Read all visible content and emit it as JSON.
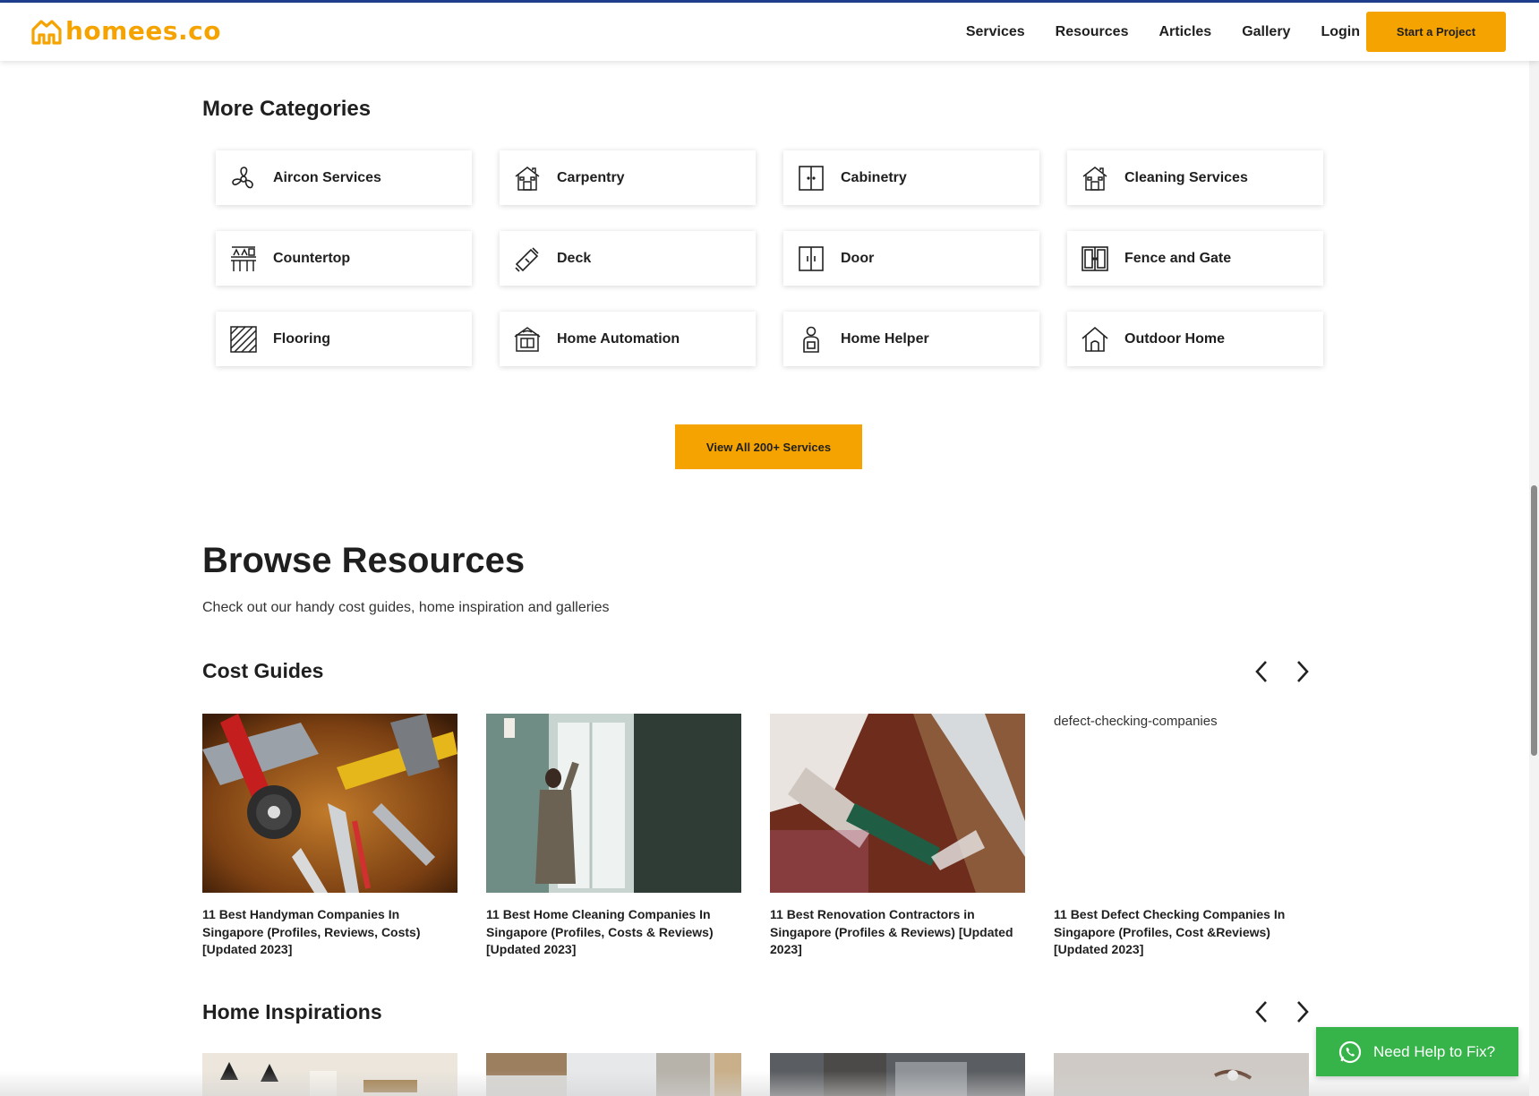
{
  "brand": {
    "name": "homees.co",
    "accent": "#f5a300",
    "top_line_color": "#1f3f8f"
  },
  "header": {
    "nav": [
      "Services",
      "Resources",
      "Articles",
      "Gallery",
      "Login"
    ],
    "cta_label": "Start a Project"
  },
  "more_categories": {
    "title": "More Categories",
    "items": [
      {
        "label": "Aircon Services",
        "icon": "fan-icon"
      },
      {
        "label": "Carpentry",
        "icon": "house-icon"
      },
      {
        "label": "Cabinetry",
        "icon": "cabinet-icon"
      },
      {
        "label": "Cleaning Services",
        "icon": "house-icon"
      },
      {
        "label": "Countertop",
        "icon": "countertop-icon"
      },
      {
        "label": "Deck",
        "icon": "plank-icon"
      },
      {
        "label": "Door",
        "icon": "door-icon"
      },
      {
        "label": "Fence and Gate",
        "icon": "gate-icon"
      },
      {
        "label": "Flooring",
        "icon": "floor-tiles-icon"
      },
      {
        "label": "Home Automation",
        "icon": "smart-home-icon"
      },
      {
        "label": "Home Helper",
        "icon": "helper-icon"
      },
      {
        "label": "Outdoor Home",
        "icon": "outdoor-home-icon"
      }
    ],
    "view_all_label": "View All 200+ Services"
  },
  "browse": {
    "title": "Browse Resources",
    "subtitle": "Check out our handy cost guides, home inspiration and galleries"
  },
  "cost_guides": {
    "title": "Cost Guides",
    "items": [
      {
        "title": "11 Best Handyman Companies In Singapore (Profiles, Reviews, Costs) [Updated 2023]"
      },
      {
        "title": "11 Best Home Cleaning Companies In Singapore (Profiles, Costs & Reviews) [Updated 2023]"
      },
      {
        "title": "11 Best Renovation Contractors in Singapore (Profiles & Reviews) [Updated 2023]"
      },
      {
        "title": "11 Best Defect Checking Companies In Singapore (Profiles, Cost &Reviews) [Updated 2023]",
        "broken_alt": "defect-checking-companies"
      }
    ]
  },
  "home_inspirations": {
    "title": "Home Inspirations"
  },
  "help": {
    "label": "Need Help to Fix?",
    "color": "#36b44a"
  }
}
